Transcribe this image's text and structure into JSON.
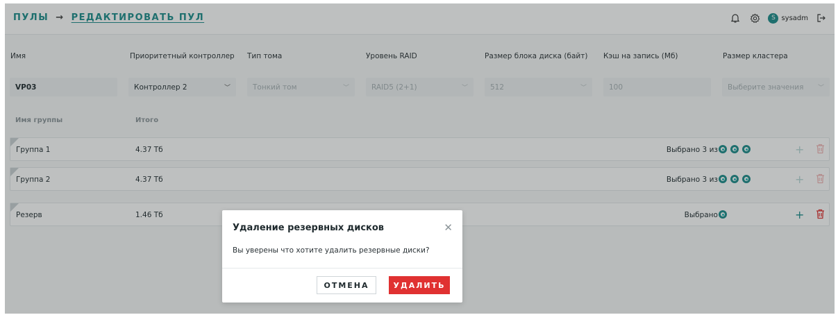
{
  "header": {
    "crumb_root": "ПУЛЫ",
    "crumb_arrow": "→",
    "crumb_current": "РЕДАКТИРОВАТЬ ПУЛ",
    "user_initial": "S",
    "username": "sysadm"
  },
  "form": {
    "labels": {
      "name": "Имя",
      "controller": "Приоритетный контроллер",
      "volume_type": "Тип тома",
      "raid_level": "Уровень RAID",
      "block_size": "Размер блока диска (байт)",
      "write_cache": "Кэш на запись (Мб)",
      "cluster_size": "Размер кластера"
    },
    "values": {
      "name": "VP03",
      "controller": "Контроллер 2",
      "volume_type": "Тонкий том",
      "raid_level": "RAID5 (2+1)",
      "block_size": "512",
      "write_cache": "100",
      "cluster_size_placeholder": "Выберите значения"
    }
  },
  "table": {
    "columns": [
      "Имя группы",
      "Итого"
    ],
    "rows": [
      {
        "name": "Группа 1",
        "total": "4.37 Тб",
        "selected": "Выбрано 3 из 3",
        "disks": 3
      },
      {
        "name": "Группа 2",
        "total": "4.37 Тб",
        "selected": "Выбрано 3 из 3",
        "disks": 3
      },
      {
        "name": "Резерв",
        "total": "1.46 Тб",
        "selected": "Выбрано 1",
        "disks": 1
      }
    ]
  },
  "modal": {
    "title": "Удаление резервных дисков",
    "message": "Вы уверены что хотите удалить резервные диски?",
    "cancel_label": "ОТМЕНА",
    "delete_label": "УДАЛИТЬ"
  },
  "colors": {
    "accent": "#1a8c8a",
    "danger": "#e03131"
  }
}
